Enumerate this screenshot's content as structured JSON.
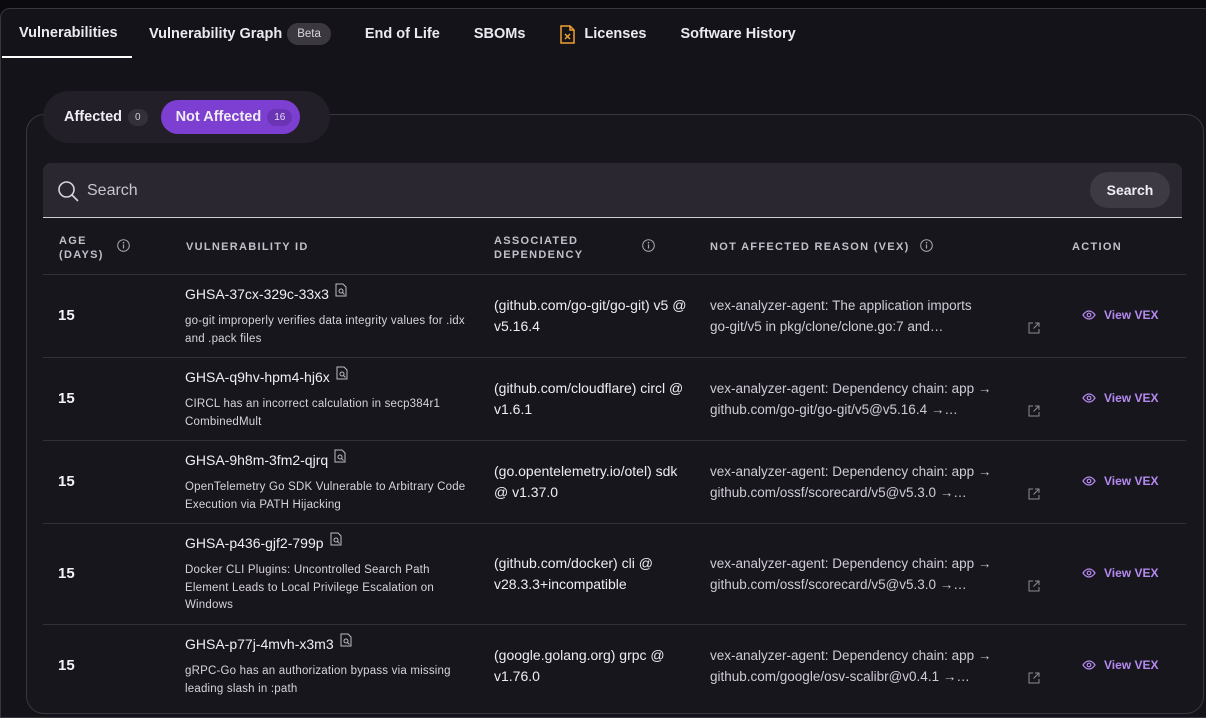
{
  "tabs": [
    {
      "label": "Vulnerabilities",
      "active": true
    },
    {
      "label": "Vulnerability Graph",
      "badge": "Beta"
    },
    {
      "label": "End of Life"
    },
    {
      "label": "SBOMs"
    },
    {
      "label": "Licenses",
      "icon": "license-file-icon"
    },
    {
      "label": "Software History"
    }
  ],
  "filter": {
    "affected_label": "Affected",
    "affected_count": "0",
    "not_affected_label": "Not Affected",
    "not_affected_count": "16",
    "selected": "Not Affected"
  },
  "search": {
    "placeholder": "Search",
    "button_label": "Search"
  },
  "columns": {
    "age": [
      "AGE",
      "(DAYS)"
    ],
    "vulnerability_id": "VULNERABILITY ID",
    "dependency": [
      "ASSOCIATED",
      "DEPENDENCY"
    ],
    "reason": "NOT AFFECTED REASON (VEX)",
    "action": "ACTION"
  },
  "rows": [
    {
      "age": "15",
      "id": "GHSA-37cx-329c-33x3",
      "description": "go-git improperly verifies data integrity values for .idx and .pack files",
      "dependency": "(github.com/go-git/go-git) v5 @ v5.16.4",
      "reason_line1": "vex-analyzer-agent: The application imports",
      "reason_line2": "go-git/v5 in pkg/clone/clone.go:7 and…",
      "action": "View VEX"
    },
    {
      "age": "15",
      "id": "GHSA-q9hv-hpm4-hj6x",
      "description": "CIRCL has an incorrect calculation in secp384r1 CombinedMult",
      "dependency": "(github.com/cloudflare) circl @ v1.6.1",
      "reason_line1": "vex-analyzer-agent: Dependency chain: app →",
      "reason_line2": "github.com/go-git/go-git/v5@v5.16.4 →…",
      "action": "View VEX"
    },
    {
      "age": "15",
      "id": "GHSA-9h8m-3fm2-qjrq",
      "description": "OpenTelemetry Go SDK Vulnerable to Arbitrary Code Execution via PATH Hijacking",
      "dependency": "(go.opentelemetry.io/otel) sdk @ v1.37.0",
      "reason_line1": "vex-analyzer-agent: Dependency chain: app →",
      "reason_line2": "github.com/ossf/scorecard/v5@v5.3.0 →…",
      "action": "View VEX"
    },
    {
      "age": "15",
      "id": "GHSA-p436-gjf2-799p",
      "description": "Docker CLI Plugins: Uncontrolled Search Path Element Leads to Local Privilege Escalation on Windows",
      "dependency": "(github.com/docker) cli @ v28.3.3+incompatible",
      "reason_line1": "vex-analyzer-agent: Dependency chain: app →",
      "reason_line2": "github.com/ossf/scorecard/v5@v5.3.0 →…",
      "action": "View VEX"
    },
    {
      "age": "15",
      "id": "GHSA-p77j-4mvh-x3m3",
      "description": "gRPC-Go has an authorization bypass via missing leading slash in :path",
      "dependency": "(google.golang.org) grpc @ v1.76.0",
      "reason_line1": "vex-analyzer-agent: Dependency chain: app →",
      "reason_line2": "github.com/google/osv-scalibr@v0.4.1 →…",
      "action": "View VEX"
    }
  ],
  "colors": {
    "accent": "#7d3fd1",
    "link": "#b48af0",
    "background": "#15131a"
  }
}
